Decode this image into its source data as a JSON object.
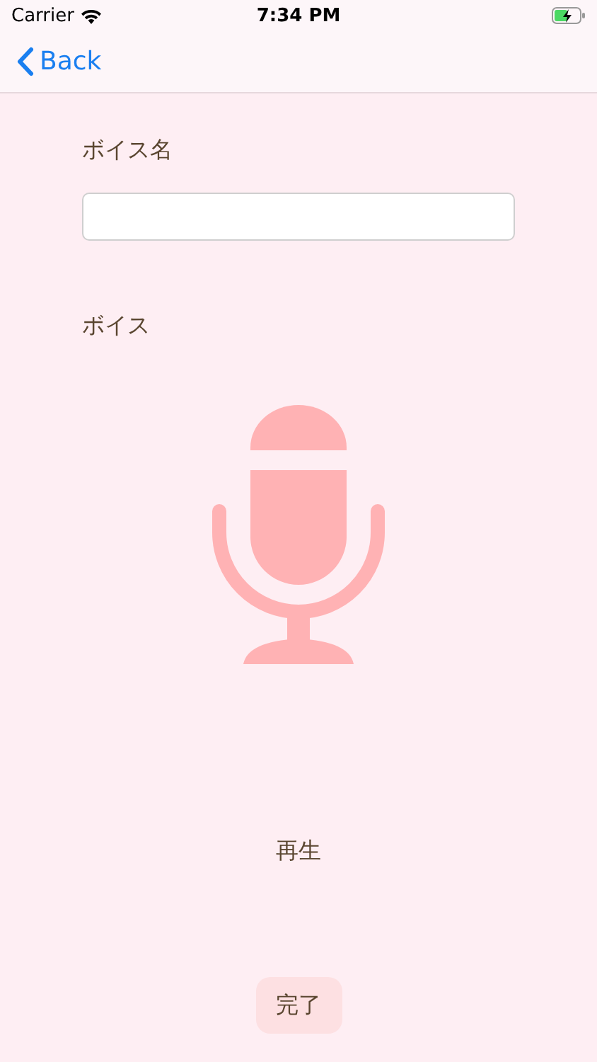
{
  "status_bar": {
    "carrier": "Carrier",
    "time": "7:34 PM",
    "battery_charging": true
  },
  "nav": {
    "back": "Back"
  },
  "name_label": "ボイス名",
  "voice_label": "ボイス",
  "play": "再生",
  "done": "完了"
}
